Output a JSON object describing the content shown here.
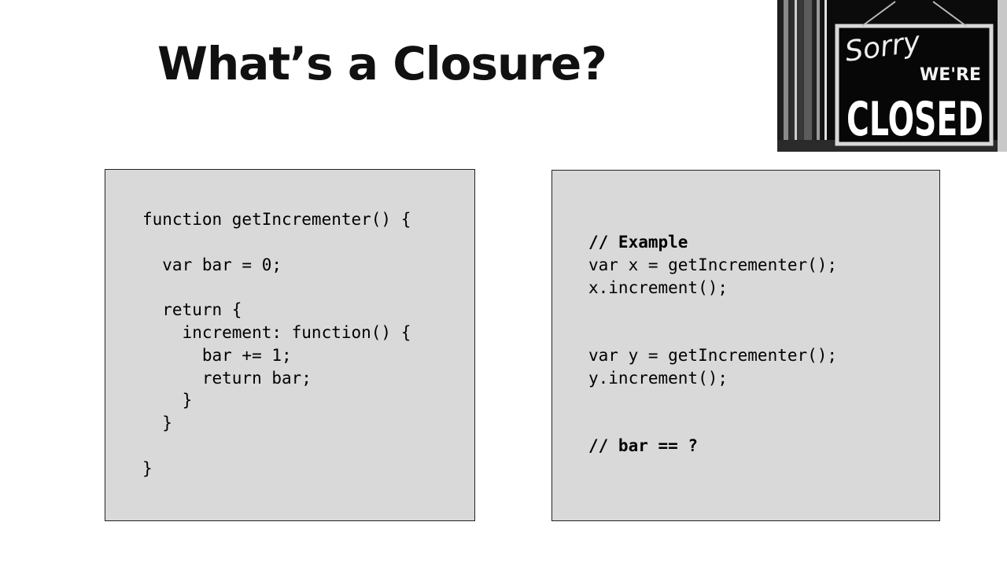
{
  "slide": {
    "title": "What’s a Closure?"
  },
  "photo": {
    "sign_script": "Sorry",
    "sign_line1": "WE'RE",
    "sign_line2": "CLOSED"
  },
  "left_code": {
    "lines": [
      "function getIncrementer() {",
      "",
      "  var bar = 0;",
      "",
      "  return {",
      "    increment: function() {",
      "      bar += 1;",
      "      return bar;",
      "    }",
      "  }",
      "",
      "}"
    ]
  },
  "right_code": {
    "lines": [
      "// Example",
      "var x = getIncrementer();",
      "x.increment();",
      "",
      "",
      "var y = getIncrementer();",
      "y.increment();",
      "",
      "",
      "// bar == ?"
    ]
  }
}
